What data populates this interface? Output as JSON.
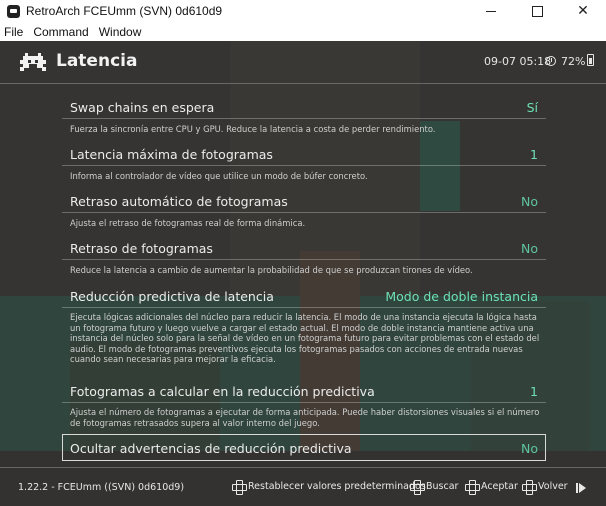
{
  "window": {
    "title": "RetroArch FCEUmm (SVN) 0d610d9",
    "minimize": "",
    "maximize": "",
    "close": "✕"
  },
  "menubar": {
    "file": "File",
    "command": "Command",
    "window": "Window"
  },
  "header": {
    "title": "Latencia",
    "datetime": "09-07 05:18",
    "battery": "72%"
  },
  "items": [
    {
      "label": "Swap chains en espera",
      "value": "Sí",
      "desc": "Fuerza la sincronía entre CPU y GPU. Reduce la latencia a costa de perder rendimiento."
    },
    {
      "label": "Latencia máxima de fotogramas",
      "value": "1",
      "desc": "Informa al controlador de vídeo que utilice un modo de búfer concreto."
    },
    {
      "label": "Retraso automático de fotogramas",
      "value": "No",
      "desc": "Ajusta el retraso de fotogramas real de forma dinámica."
    },
    {
      "label": "Retraso de fotogramas",
      "value": "No",
      "desc": "Reduce la latencia a cambio de aumentar la probabilidad de que se produzcan tirones de vídeo."
    },
    {
      "label": "Reducción predictiva de latencia",
      "value": "Modo de doble instancia",
      "desc": "Ejecuta lógicas adicionales del núcleo para reducir la latencia. El modo de una instancia ejecuta la lógica hasta un fotograma futuro y luego vuelve a cargar el estado actual. El modo de doble instancia mantiene activa una instancia del núcleo solo para la señal de vídeo en un fotograma futuro para evitar problemas con el estado del audio. El modo de fotogramas preventivos ejecuta los fotogramas pasados con acciones de entrada nuevas cuando sean necesarias para mejorar la eficacia."
    },
    {
      "label": "Fotogramas a calcular en la reducción predictiva",
      "value": "1",
      "desc": "Ajusta el número de fotogramas a ejecutar de forma anticipada. Puede haber distorsiones visuales si el número de fotogramas retrasados supera al valor interno del juego."
    },
    {
      "label": "Ocultar advertencias de reducción predictiva",
      "value": "No",
      "desc": ""
    }
  ],
  "footer": {
    "version": "1.22.2 - FCEUmm ((SVN) 0d610d9)",
    "reset": "Restablecer valores predeterminados",
    "search": "Buscar",
    "accept": "Aceptar",
    "back": "Volver"
  },
  "colors": {
    "accent": "#6ee0b4",
    "text": "#ececec"
  },
  "icons": [
    "retroarch-invader-icon",
    "clock-icon",
    "battery-icon",
    "dpad-icon",
    "play-icon"
  ]
}
